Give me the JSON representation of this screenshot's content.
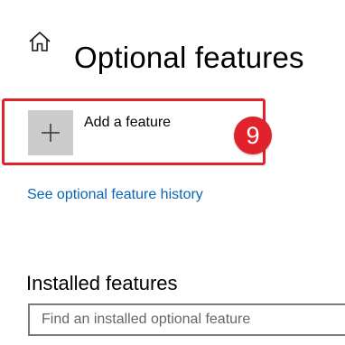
{
  "header": {
    "home_icon": "home-icon",
    "title": "Optional features"
  },
  "add_feature": {
    "icon": "plus-icon",
    "label": "Add a feature",
    "highlight_color": "#e0222b"
  },
  "step_badge": {
    "number": "9",
    "color": "#e0222b"
  },
  "history_link": {
    "label": "See optional feature history",
    "color": "#0a64b4"
  },
  "installed": {
    "heading": "Installed features",
    "search_placeholder": "Find an installed optional feature"
  }
}
